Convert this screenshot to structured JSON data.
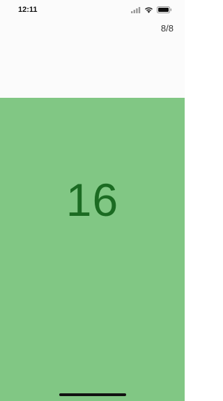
{
  "status_bar": {
    "time": "12:11",
    "icons": [
      "signal-icon",
      "wifi-icon",
      "battery-icon"
    ]
  },
  "header": {
    "progress": "8/8"
  },
  "card": {
    "value": "16",
    "background_color": "#81c784",
    "text_color": "#1b6b22"
  }
}
